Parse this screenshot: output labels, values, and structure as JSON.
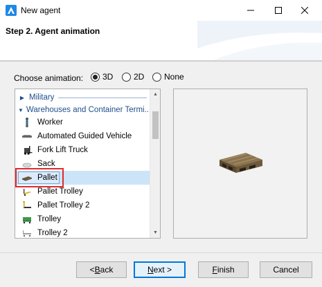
{
  "window": {
    "title": "New agent"
  },
  "header": {
    "step_title": "Step 2. Agent animation"
  },
  "animation": {
    "label": "Choose animation:",
    "options": [
      "3D",
      "2D",
      "None"
    ],
    "selected": "3D"
  },
  "list": {
    "groups": [
      {
        "label": "Military",
        "expanded": false
      },
      {
        "label": "Warehouses and Container Termi...",
        "expanded": true
      }
    ],
    "items": [
      {
        "label": "Worker",
        "icon": "worker-icon"
      },
      {
        "label": "Automated Guided Vehicle",
        "icon": "agv-icon"
      },
      {
        "label": "Fork Lift Truck",
        "icon": "forklift-icon"
      },
      {
        "label": "Sack",
        "icon": "sack-icon"
      },
      {
        "label": "Pallet",
        "icon": "pallet-icon",
        "selected": true
      },
      {
        "label": "Pallet Trolley",
        "icon": "pallet-trolley-icon"
      },
      {
        "label": "Pallet Trolley 2",
        "icon": "pallet-trolley-2-icon"
      },
      {
        "label": "Trolley",
        "icon": "trolley-icon"
      },
      {
        "label": "Trolley 2",
        "icon": "trolley-2-icon"
      }
    ]
  },
  "preview": {
    "icon": "pallet-3d-preview"
  },
  "buttons": {
    "back": "< Back",
    "next": "Next >",
    "finish": "Finish",
    "cancel": "Cancel"
  },
  "colors": {
    "accent": "#0078d7",
    "highlight": "#e02a2a",
    "group_text": "#1f4e8c"
  }
}
